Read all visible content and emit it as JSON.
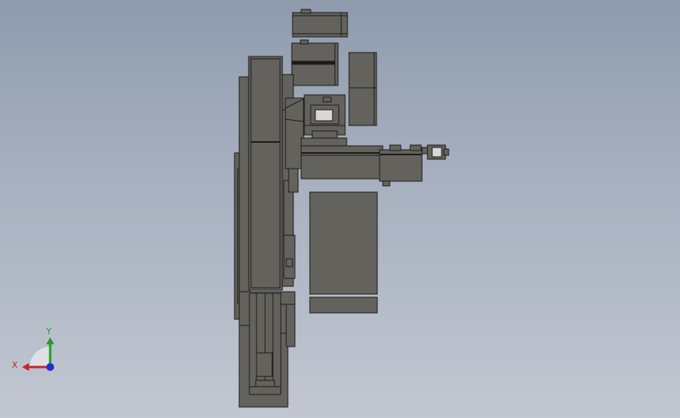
{
  "viewport": {
    "background_top": "#8f9bad",
    "background_bottom": "#c2c7d1",
    "part_fill": "#64625c",
    "part_stroke": "#1c1c1a"
  },
  "triad": {
    "x_label": "X",
    "y_label": "Y",
    "x_color": "#c0282a",
    "y_color": "#1f9e2c",
    "z_color": "#2430c8"
  }
}
